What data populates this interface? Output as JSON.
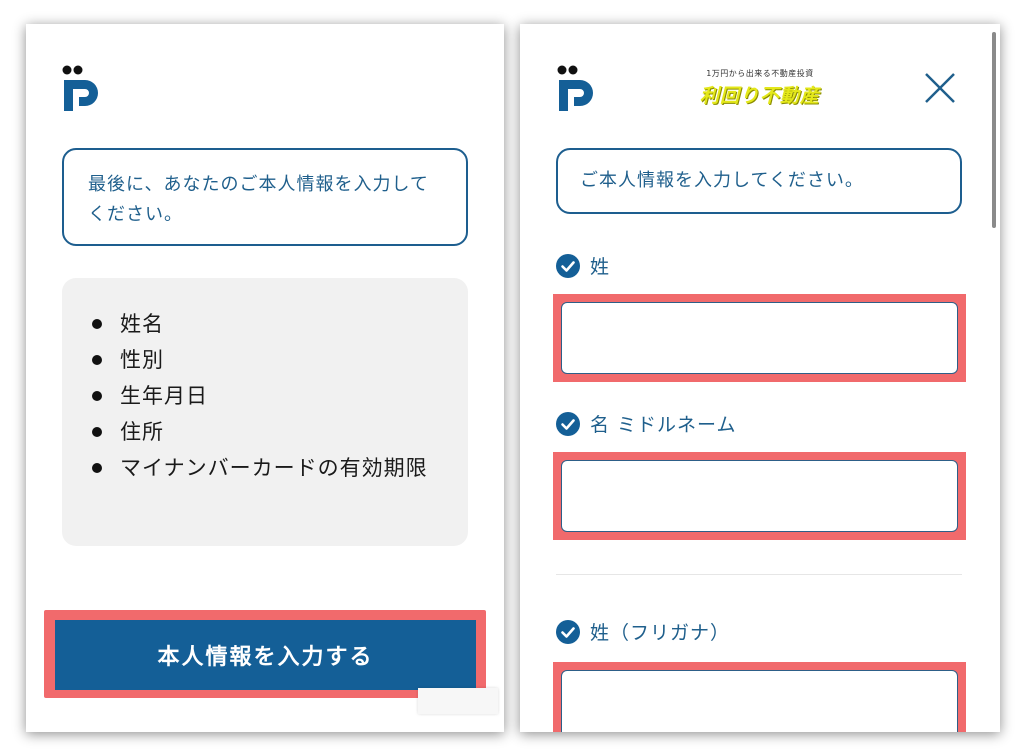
{
  "colors": {
    "brand_blue": "#145f97",
    "text_blue": "#1f5f8c",
    "highlight_red": "#f16a6c",
    "brand_yellow": "#e4e81a",
    "list_background": "#f1f1f1"
  },
  "left": {
    "logo_icon": "p-logo-icon",
    "message": "最後に、あなたのご本人情報を入力してください。",
    "list_items": [
      "姓名",
      "性別",
      "生年月日",
      "住所",
      "マイナンバーカードの有効期限"
    ],
    "button_label": "本人情報を入力する"
  },
  "right": {
    "logo_icon": "p-logo-icon",
    "brand": {
      "tagline": "1万円から出来る不動産投資",
      "name": "利回り不動産"
    },
    "close_icon": "close-icon",
    "message": "ご本人情報を入力してください。",
    "fields": [
      {
        "label": "姓",
        "value": ""
      },
      {
        "label": "名 ミドルネーム",
        "value": ""
      },
      {
        "label": "姓（フリガナ）",
        "value": ""
      }
    ]
  }
}
